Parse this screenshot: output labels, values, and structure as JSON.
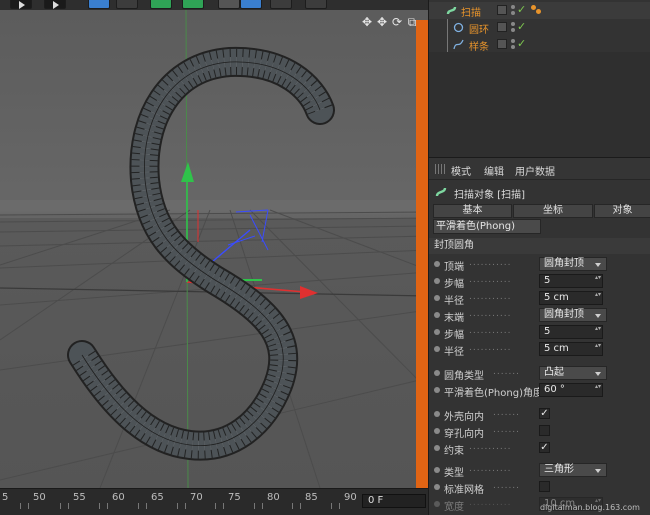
{
  "colors": {
    "viewport_bg": "#5f5f5f",
    "panel_bg": "#333333",
    "accent_orange": "#e8942b",
    "axis_x": "#e03030",
    "axis_y": "#2fc34a",
    "axis_z": "#3a4cff"
  },
  "toolbar": {
    "icons": [
      "play-icon",
      "play-icon",
      "cube-icon",
      "cog-add-icon",
      "green-cog-icon",
      "sphere-icon",
      "light-icon"
    ]
  },
  "viewport": {
    "nav_icons": [
      "move-view-icon",
      "scroll-view-icon",
      "rotate-view-icon",
      "maximize-icon"
    ],
    "nav_glyphs": [
      "✥",
      "✥",
      "⟳",
      "⧉"
    ]
  },
  "timeline": {
    "ticks": [
      "5",
      "50",
      "55",
      "60",
      "65",
      "70",
      "75",
      "80",
      "85",
      "90"
    ],
    "frame": "0 F"
  },
  "object_manager": {
    "objects": [
      {
        "name": "扫描",
        "icon": "sweep-icon"
      },
      {
        "name": "圆环",
        "icon": "circle-spline-icon"
      },
      {
        "name": "样条",
        "icon": "spline-icon"
      }
    ]
  },
  "attribute_manager": {
    "menu": [
      "模式",
      "编辑",
      "用户数据"
    ],
    "object_title": "扫描对象 [扫描]",
    "tabs": [
      "基本",
      "坐标",
      "对象"
    ],
    "subtab": "平滑着色(Phong)",
    "section": "封顶圆角",
    "params": [
      {
        "label": "顶端",
        "type": "dropdown",
        "value": "圆角封顶"
      },
      {
        "label": "步幅",
        "type": "number",
        "value": "5"
      },
      {
        "label": "半径",
        "type": "number",
        "value": "5 cm"
      },
      {
        "label": "末端",
        "type": "dropdown",
        "value": "圆角封顶"
      },
      {
        "label": "步幅",
        "type": "number",
        "value": "5"
      },
      {
        "label": "半径",
        "type": "number",
        "value": "5 cm"
      },
      {
        "label": "圆角类型",
        "type": "dropdown",
        "value": "凸起"
      },
      {
        "label": "平滑着色(Phong)角度",
        "type": "number",
        "value": "60 °"
      },
      {
        "label": "外壳向内",
        "type": "check",
        "value": "✓"
      },
      {
        "label": "穿孔向内",
        "type": "check",
        "value": ""
      },
      {
        "label": "约束",
        "type": "check",
        "value": "✓"
      },
      {
        "label": "类型",
        "type": "dropdown",
        "value": "三角形"
      },
      {
        "label": "标准网格",
        "type": "check",
        "value": ""
      },
      {
        "label": "宽度",
        "type": "number",
        "value": "10 cm"
      }
    ]
  },
  "watermark": "digitalman.blog.163.com"
}
